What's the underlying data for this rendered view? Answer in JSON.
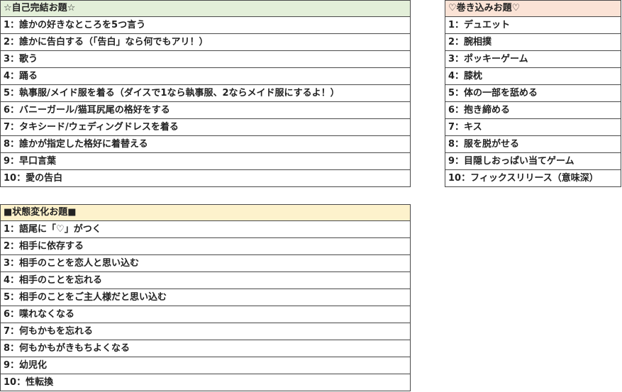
{
  "self_table": {
    "title": "☆自己完結お題☆",
    "header_color": "#e3efd9",
    "items": [
      "1：誰かの好きなところを5つ言う",
      "2：誰かに告白する（「告白」なら何でもアリ！）",
      "3：歌う",
      "4：踊る",
      "5：執事服/メイド服を着る（ダイスで1なら執事服、2ならメイド服にするよ！）",
      "6：バニーガール/猫耳尻尾の格好をする",
      "7：タキシード/ウェディングドレスを着る",
      "8：誰かが指定した格好に着替える",
      "9：早口言葉",
      "10：愛の告白"
    ]
  },
  "involve_table": {
    "title": "♡巻き込みお題♡",
    "header_color": "#fbe3d6",
    "items": [
      "1：デュエット",
      "2：腕相撲",
      "3：ポッキーゲーム",
      "4：膝枕",
      "5：体の一部を舐める",
      "6：抱き締める",
      "7：キス",
      "8：服を脱がせる",
      "9：目隠しおっぱい当てゲーム",
      "10：フィックスリリース（意味深）"
    ]
  },
  "state_table": {
    "title": "■状態変化お題■",
    "header_color": "#fdf2cc",
    "items": [
      "1：語尾に「♡」がつく",
      "2：相手に依存する",
      "3：相手のことを恋人と思い込む",
      "4：相手のことを忘れる",
      "5：相手のことをご主人様だと思い込む",
      "6：喋れなくなる",
      "7：何もかもを忘れる",
      "8：何もかもがきもちよくなる",
      "9：幼児化",
      "10：性転換"
    ]
  }
}
